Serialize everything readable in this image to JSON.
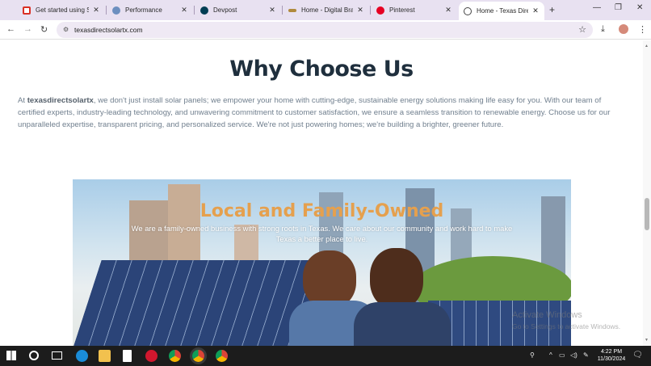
{
  "browser": {
    "tabs": [
      {
        "title": "Get started using Se",
        "favicon": "gmail-icon",
        "color": "#d93025"
      },
      {
        "title": "Performance",
        "favicon": "performance-icon",
        "color": "#5f6368"
      },
      {
        "title": "Devpost",
        "favicon": "devpost-icon",
        "color": "#003e54"
      },
      {
        "title": "Home - Digital Brand",
        "favicon": "digital-brand-icon",
        "color": "#b08a3c"
      },
      {
        "title": "Pinterest",
        "favicon": "pinterest-icon",
        "color": "#e60023"
      },
      {
        "title": "Home - Texas Direct",
        "favicon": "globe-icon",
        "color": "#444444",
        "active": true
      }
    ],
    "new_tab": "+",
    "window_controls": {
      "minimize": "—",
      "restore": "❐",
      "close": "✕"
    },
    "url": "texasdirectsolartx.com"
  },
  "page": {
    "heading": "Why Choose Us",
    "intro_brand": "texasdirectsolartx",
    "intro_prefix": "At ",
    "intro_text": ", we don't just install solar panels; we empower your home with cutting-edge, sustainable energy solutions making life easy for you. With our team of certified experts, industry-leading technology, and unwavering commitment to customer satisfaction, we ensure a seamless transition to renewable energy. Choose us for our unparalleled expertise, transparent pricing, and personalized service. We're not just powering homes; we're building a brighter, greener future.",
    "hero": {
      "title": "Local and Family-Owned",
      "subtitle": "We are a family-owned business with strong roots in Texas. We care about our community and work hard to make Texas a better place to live."
    }
  },
  "os": {
    "watermark_title": "Activate Windows",
    "watermark_sub": "Go to Settings to activate Windows.",
    "time": "4:22 PM",
    "date": "11/30/2024"
  },
  "colors": {
    "heading": "#1f2f3d",
    "hero_title": "#e5a04e",
    "body_text": "#707f8e",
    "tabbar": "#e8e1f1"
  }
}
